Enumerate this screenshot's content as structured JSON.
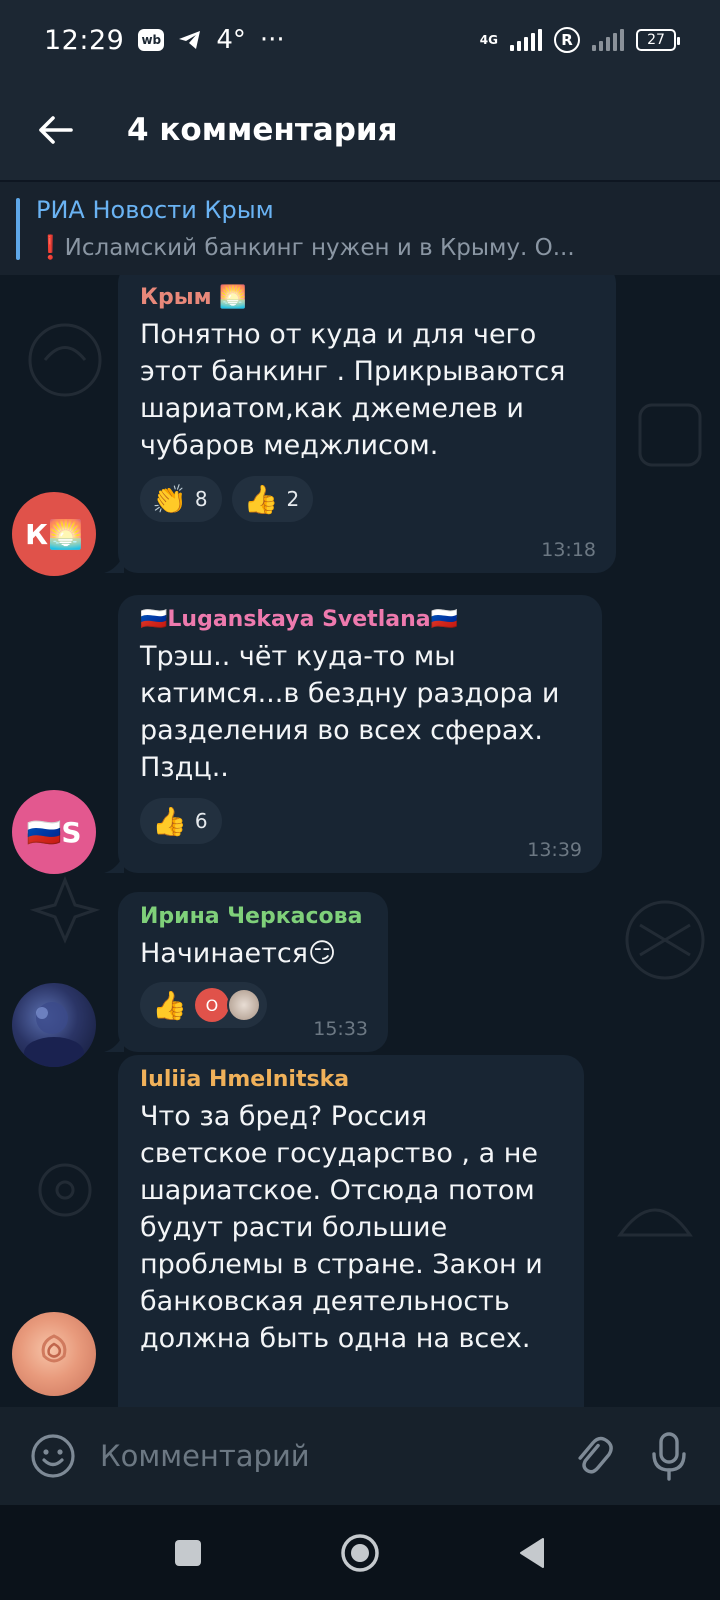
{
  "status_bar": {
    "time": "12:29",
    "wb": "wb",
    "temp": "4°",
    "more": "···",
    "network": "4G",
    "roaming": "R",
    "battery": "27"
  },
  "header": {
    "title": "4 комментария"
  },
  "pinned": {
    "title": "РИА Новости Крым",
    "bang": "❗",
    "text": "Исламский банкинг нужен и в Крыму.  О..."
  },
  "messages": [
    {
      "author": "Крым 🌅",
      "author_color": "#e8887a",
      "avatar_text": "К🌅",
      "avatar_color": "#e0524a",
      "text": "Понятно от куда и   для чего этот банкинг . Прикрываются шариатом,как джемелев и чубаров меджлисом.",
      "reactions": [
        {
          "emoji": "👏",
          "count": "8"
        },
        {
          "emoji": "👍",
          "count": "2"
        }
      ],
      "time": "13:18"
    },
    {
      "author": "🇷🇺Luganskaya Svetlana🇷🇺",
      "author_color": "#ee7aae",
      "avatar_text": "🇷🇺S",
      "avatar_color": "#e3588f",
      "text": "Трэш.. чёт куда-то мы катимся...в бездну раздора и разделения во всех сферах. Пздц..",
      "reactions": [
        {
          "emoji": "👍",
          "count": "6"
        }
      ],
      "time": "13:39"
    },
    {
      "author": "Ирина Черкасова",
      "author_color": "#7fd07a",
      "text": "Начинается😏",
      "reactions": [
        {
          "emoji": "👍",
          "reactor": "О"
        }
      ],
      "time": "15:33"
    },
    {
      "author": "Iuliia Hmelnitska",
      "author_color": "#f0b15a",
      "text": "Что за бред? Россия светское государство , а не шариатское. Отсюда потом будут расти большие проблемы в стране. Закон и банковская деятельность должна быть одна на всех."
    }
  ],
  "composer": {
    "placeholder": "Комментарий"
  },
  "colors": {
    "background": "#0e1621",
    "bubble": "#182533",
    "accent": "#6ab3f3"
  }
}
